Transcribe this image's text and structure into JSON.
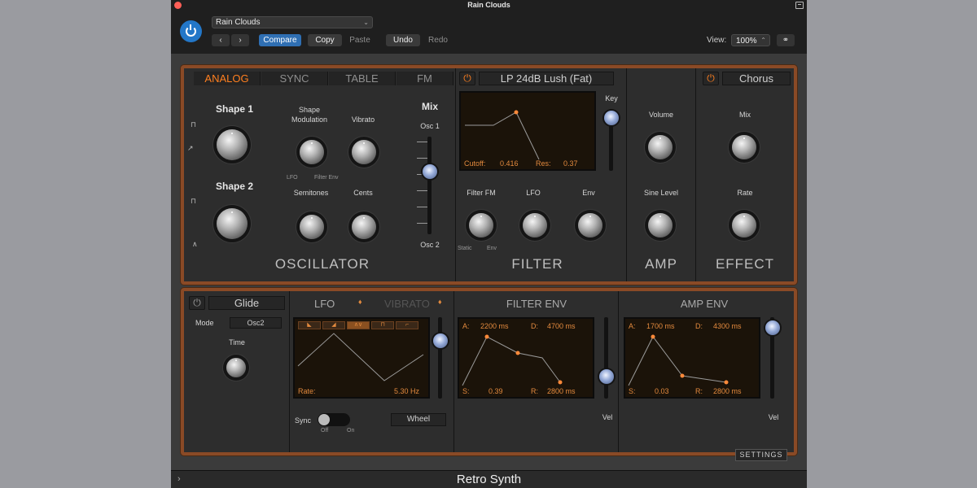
{
  "window": {
    "title": "Retro Synth",
    "titlebar_title": "Rain Clouds"
  },
  "header": {
    "preset": "Rain Clouds",
    "compare": "Compare",
    "copy": "Copy",
    "paste": "Paste",
    "undo": "Undo",
    "redo": "Redo",
    "view_label": "View:",
    "view_value": "100%",
    "nav_back": "‹",
    "nav_fwd": "›"
  },
  "osc": {
    "tabs": [
      "ANALOG",
      "SYNC",
      "TABLE",
      "FM"
    ],
    "active_tab": "ANALOG",
    "shape1": "Shape 1",
    "shape2": "Shape 2",
    "shape_mod_1": "Shape",
    "shape_mod_2": "Modulation",
    "vibrato": "Vibrato",
    "mix": "Mix",
    "osc1": "Osc 1",
    "osc2": "Osc 2",
    "lfo": "LFO",
    "filter_env": "Filter Env",
    "semitones": "Semitones",
    "cents": "Cents",
    "title": "OSCILLATOR"
  },
  "filter": {
    "name": "LP 24dB Lush (Fat)",
    "key": "Key",
    "cutoff_label": "Cutoff:",
    "cutoff": "0.416",
    "res_label": "Res:",
    "res": "0.37",
    "filter_fm": "Filter FM",
    "lfo": "LFO",
    "env": "Env",
    "static": "Static",
    "env2": "Env",
    "title": "FILTER"
  },
  "amp": {
    "volume": "Volume",
    "sine_level": "Sine Level",
    "title": "AMP"
  },
  "effect": {
    "name": "Chorus",
    "mix": "Mix",
    "rate": "Rate",
    "title": "EFFECT"
  },
  "glide": {
    "name": "Glide",
    "mode_label": "Mode",
    "mode": "Osc2",
    "time": "Time"
  },
  "lfo_sec": {
    "lfo": "LFO",
    "vibrato": "VIBRATO",
    "rate_label": "Rate:",
    "rate": "5.30 Hz",
    "sync": "Sync",
    "off": "Off",
    "on": "On",
    "wheel": "Wheel"
  },
  "filter_env": {
    "title": "FILTER ENV",
    "a_label": "A:",
    "a": "2200 ms",
    "d_label": "D:",
    "d": "4700 ms",
    "s_label": "S:",
    "s": "0.39",
    "r_label": "R:",
    "r": "2800 ms",
    "vel": "Vel"
  },
  "amp_env": {
    "title": "AMP ENV",
    "a_label": "A:",
    "a": "1700 ms",
    "d_label": "D:",
    "d": "4300 ms",
    "s_label": "S:",
    "s": "0.03",
    "r_label": "R:",
    "r": "2800 ms",
    "vel": "Vel"
  },
  "settings": "SETTINGS",
  "colors": {
    "accent": "#ff7f1f",
    "compare": "#2f6fb3",
    "wood": "#8a4a26"
  }
}
